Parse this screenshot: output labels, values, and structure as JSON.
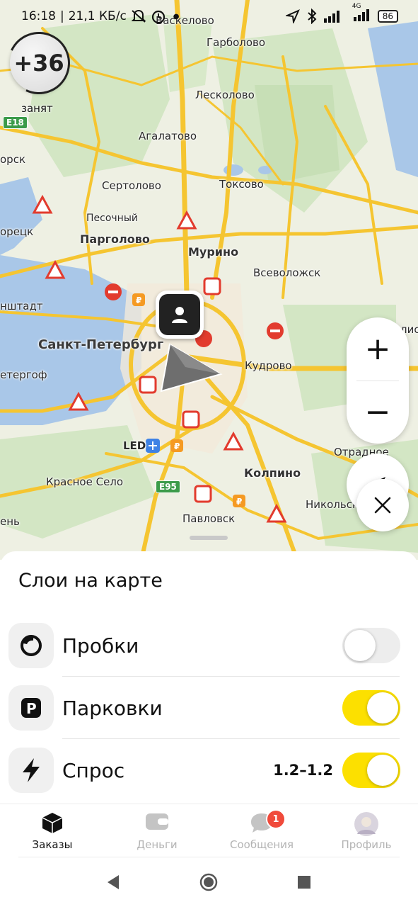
{
  "status_bar": {
    "time": "16:18",
    "separator": "|",
    "net_speed": "21,1 КБ/с",
    "network": "4G",
    "battery": "86"
  },
  "driver": {
    "rating": "+36",
    "state": "занят"
  },
  "map": {
    "places": {
      "vaskelovo": "Васкелово",
      "garbolovo": "Гарболово",
      "leskolovo": "Лесколово",
      "agalatovo": "Агалатово",
      "sertolovo": "Сертолово",
      "toksovo": "Токсово",
      "pesochny": "Песочный",
      "pargolovo": "Парголово",
      "murino": "Мурино",
      "vsevolozhsk": "Всеволожск",
      "sestroretsk": "орецк",
      "kronshtadt": "нштадт",
      "spb": "Санкт-Петербург",
      "kudrovo": "Кудрово",
      "peterhof": "етергоф",
      "led": "LED",
      "krasnoe_selo": "Красное Село",
      "otradnoe": "Отрадное",
      "kolpino": "Колпино",
      "nikolskoe": "Никольск",
      "pavlovsk": "Павловск",
      "lomonosov": "ень",
      "e18": "E18",
      "e95": "E95",
      "edge_top_left": "орск",
      "edge_right": "лис"
    },
    "accent_color": "#fce000",
    "road_color": "#f5c531"
  },
  "controls": {
    "zoom_in": "+",
    "zoom_out": "−",
    "close": "×"
  },
  "layers_sheet": {
    "title": "Слои на карте",
    "rows": [
      {
        "label": "Пробки",
        "value": "",
        "enabled": false,
        "icon": "traffic-icon"
      },
      {
        "label": "Парковки",
        "value": "",
        "enabled": true,
        "icon": "parking-icon"
      },
      {
        "label": "Спрос",
        "value": "1.2–1.2",
        "enabled": true,
        "icon": "lightning-icon"
      }
    ]
  },
  "tabs": [
    {
      "label": "Заказы",
      "icon": "orders-icon",
      "active": true
    },
    {
      "label": "Деньги",
      "icon": "wallet-icon",
      "active": false
    },
    {
      "label": "Сообщения",
      "icon": "chat-icon",
      "active": false,
      "badge": "1"
    },
    {
      "label": "Профиль",
      "icon": "avatar-icon",
      "active": false
    }
  ],
  "system_nav": {
    "back": "back",
    "home": "home",
    "recents": "recents"
  }
}
